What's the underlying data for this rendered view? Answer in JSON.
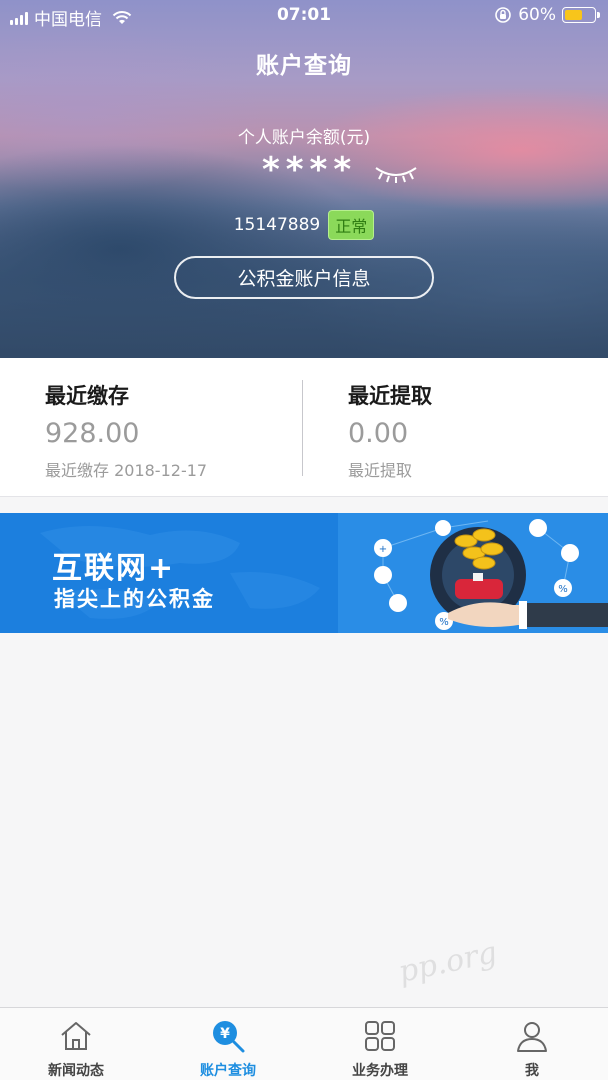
{
  "status_bar": {
    "carrier": "中国电信",
    "time": "07:01",
    "battery_percent": "60%",
    "battery_level": 0.6
  },
  "header": {
    "title": "账户查询",
    "balance_label": "个人账户余额(元)",
    "balance_masked": "****",
    "account_number": "15147889",
    "account_status": "正常",
    "account_info_button": "公积金账户信息",
    "eye_icon": "closed-eye-icon"
  },
  "summary": {
    "deposit": {
      "title": "最近缴存",
      "amount": "928.00",
      "detail": "最近缴存 2018-12-17"
    },
    "withdrawal": {
      "title": "最近提取",
      "amount": "0.00",
      "detail": "最近提取"
    }
  },
  "banner": {
    "title": "互联网+",
    "subtitle": "指尖上的公积金"
  },
  "tabbar": {
    "tabs": [
      {
        "label": "新闻动态",
        "icon": "home-icon",
        "active": false
      },
      {
        "label": "账户查询",
        "icon": "yuan-search-icon",
        "active": true
      },
      {
        "label": "业务办理",
        "icon": "grid-icon",
        "active": false
      },
      {
        "label": "我",
        "icon": "user-icon",
        "active": false
      }
    ]
  },
  "watermark": "pp.org",
  "colors": {
    "accent": "#1e8ee0",
    "status_badge_bg": "#8bd95a",
    "banner_bg": "#1c7fde"
  }
}
